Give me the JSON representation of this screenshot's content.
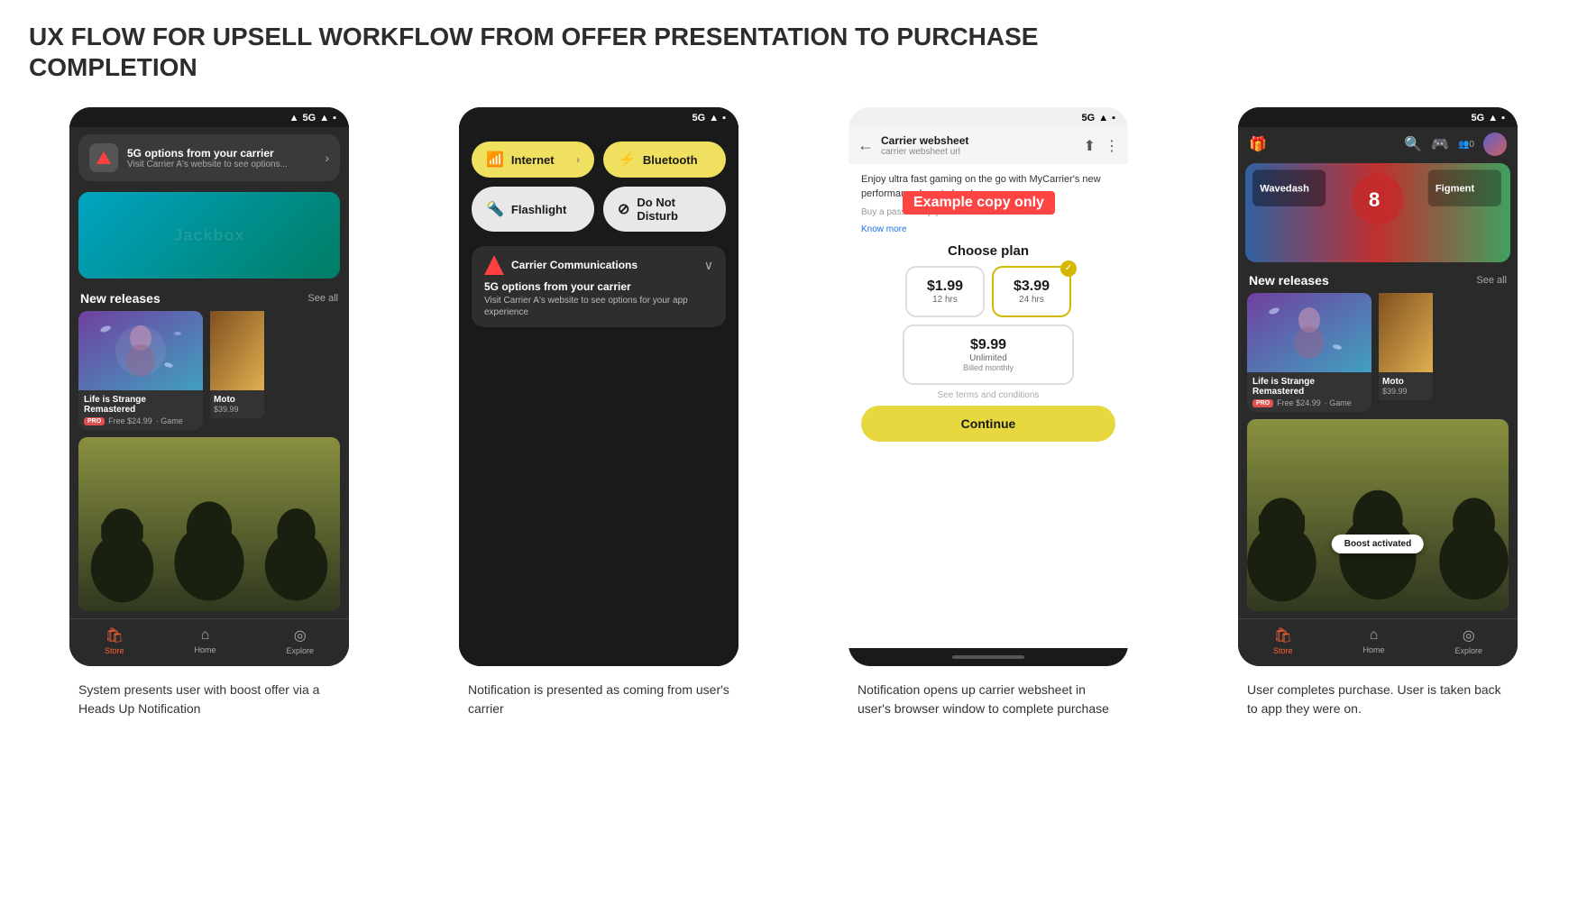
{
  "page": {
    "title_line1": "UX FLOW FOR UPSELL WORKFLOW FROM OFFER PRESENTATION TO PURCHASE",
    "title_line2": "COMPLETION"
  },
  "screen1": {
    "status": "5G",
    "notification": {
      "title": "5G options from your carrier",
      "subtitle": "Visit Carrier A's website to see options..."
    },
    "hero_label": "Jackbox",
    "section_title": "New releases",
    "see_all": "See all",
    "game1": {
      "title": "Life is Strange Remastered",
      "badge": "PRO",
      "price": "Free $24.99",
      "type": "Game"
    },
    "game2_partial": "Moto",
    "game2_price": "$39.99",
    "nav": {
      "store": "Store",
      "home": "Home",
      "explore": "Explore"
    },
    "caption": "System presents user with boost offer via a Heads Up Notification"
  },
  "screen2": {
    "status": "5G",
    "toggle1": {
      "label": "Internet",
      "active": true
    },
    "toggle2": {
      "label": "Bluetooth",
      "active": true
    },
    "toggle3": {
      "label": "Flashlight",
      "active": false
    },
    "toggle4": {
      "label": "Do Not Disturb",
      "active": false
    },
    "carrier": {
      "name": "Carrier Communications",
      "notif_title": "5G options from your carrier",
      "notif_body": "Visit Carrier A's website to see options for your app experience"
    },
    "caption": "Notification is presented as coming from user's carrier"
  },
  "screen3": {
    "status": "5G",
    "topbar": {
      "title": "Carrier websheet",
      "url": "carrier websheet url"
    },
    "body_text": "Enjoy ultra fast gaming on the go with MyCarrier's new performance boost plans!",
    "body_text2": "Buy a pass to enjoy u... rates for t...",
    "example_overlay": "Example copy only",
    "know_more": "Know more",
    "choose_plan": "Choose plan",
    "plan1": {
      "price": "$1.99",
      "duration": "12 hrs"
    },
    "plan2": {
      "price": "$3.99",
      "duration": "24 hrs",
      "selected": true
    },
    "plan3": {
      "price": "$9.99",
      "duration": "Unlimited",
      "billing": "Billed monthly"
    },
    "terms": "See terms and conditions",
    "continue_btn": "Continue",
    "caption": "Notification opens up carrier websheet in user's browser window to complete purchase"
  },
  "screen4": {
    "status": "5G",
    "section_title": "New releases",
    "see_all": "See all",
    "game1": {
      "title": "Life is Strange Remastered",
      "badge": "PRO",
      "price": "Free $24.99",
      "type": "Game"
    },
    "game2_partial": "Moto",
    "game2_price": "$39.99",
    "boost_badge": "Boost activated",
    "nav": {
      "store": "Store",
      "home": "Home",
      "explore": "Explore"
    },
    "caption": "User completes purchase. User is taken back to app they were on."
  },
  "icons": {
    "signal": "▲",
    "battery": "🔋",
    "wifi": "📶",
    "store": "🛍",
    "home": "⌂",
    "explore": "◎",
    "search": "🔍",
    "gamepad": "🎮",
    "people": "👥",
    "gift": "🎁",
    "back": "←",
    "share": "⬆",
    "more": "⋮",
    "chevron": "›",
    "expand": "∨",
    "internet": "📶",
    "bluetooth": "⚡",
    "flashlight": "🔦",
    "donotdisturb": "⊘"
  }
}
